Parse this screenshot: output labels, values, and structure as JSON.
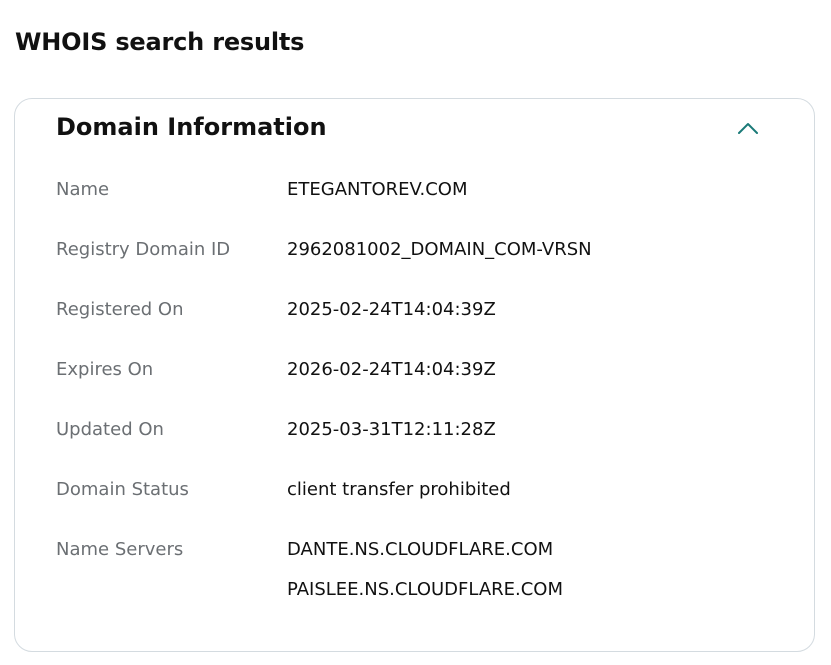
{
  "page": {
    "title": "WHOIS search results"
  },
  "domain_info": {
    "title": "Domain Information",
    "toggle_icon": "chevron-up-icon",
    "accent_color": "#1a7a78",
    "rows": {
      "name": {
        "label": "Name",
        "value": "ETEGANTOREV.COM"
      },
      "registry_domain_id": {
        "label": "Registry Domain ID",
        "value": "2962081002_DOMAIN_COM-VRSN"
      },
      "registered_on": {
        "label": "Registered On",
        "value": "2025-02-24T14:04:39Z"
      },
      "expires_on": {
        "label": "Expires On",
        "value": "2026-02-24T14:04:39Z"
      },
      "updated_on": {
        "label": "Updated On",
        "value": "2025-03-31T12:11:28Z"
      },
      "domain_status": {
        "label": "Domain Status",
        "value": "client transfer prohibited"
      },
      "name_servers": {
        "label": "Name Servers",
        "values": [
          "DANTE.NS.CLOUDFLARE.COM",
          "PAISLEE.NS.CLOUDFLARE.COM"
        ]
      }
    }
  }
}
